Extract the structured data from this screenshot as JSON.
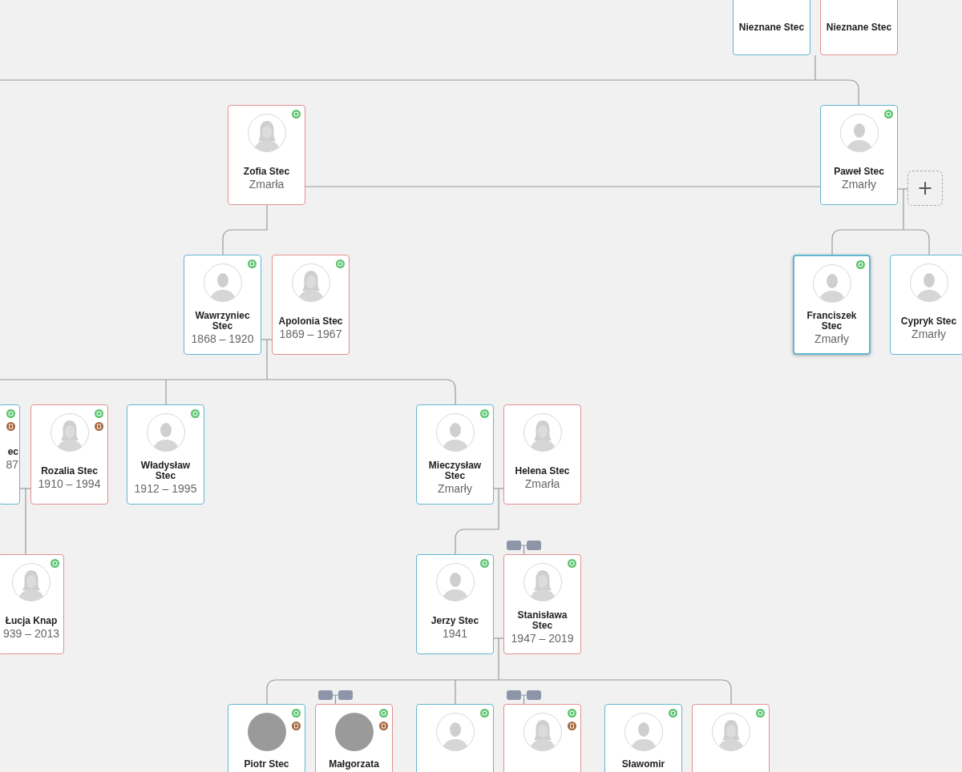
{
  "people": [
    {
      "name": "Nieznane Stec",
      "kind": "male",
      "avatar": false,
      "selected": false,
      "synced": false,
      "has_document": false
    },
    {
      "name": "Nieznane Stec",
      "kind": "female",
      "avatar": false,
      "selected": false,
      "synced": false,
      "has_document": false
    },
    {
      "name": "Zofia Stec",
      "dates": "Zmarła",
      "kind": "female",
      "avatar": true,
      "has_photo": false,
      "selected": false,
      "synced": true,
      "has_document": false,
      "partner_icon": false
    },
    {
      "name": "Paweł Stec",
      "dates": "Zmarły",
      "kind": "male",
      "avatar": true,
      "has_photo": false,
      "selected": false,
      "synced": true,
      "has_document": false,
      "partner_icon": false
    },
    {
      "name": "Wawrzyniec Stec",
      "dates": "1868 – 1920",
      "kind": "male",
      "avatar": true,
      "has_photo": false,
      "selected": false,
      "synced": true,
      "has_document": false,
      "partner_icon": false
    },
    {
      "name": "Apolonia Stec",
      "dates": "1869 – 1967",
      "kind": "female",
      "avatar": true,
      "has_photo": false,
      "selected": false,
      "synced": true,
      "has_document": false,
      "partner_icon": false
    },
    {
      "name": "Franciszek Stec",
      "dates": "Zmarły",
      "kind": "male",
      "avatar": true,
      "has_photo": false,
      "selected": true,
      "synced": true,
      "has_document": false,
      "partner_icon": false
    },
    {
      "name": "Cypryk Stec",
      "dates": "Zmarły",
      "kind": "male",
      "avatar": true,
      "has_photo": false,
      "selected": false,
      "synced": false,
      "has_document": false,
      "partner_icon": false
    },
    {
      "name": "ec",
      "dates": "87",
      "kind": "male",
      "avatar": false,
      "selected": false,
      "synced": true,
      "has_document": true,
      "partner_icon": false
    },
    {
      "name": "Rozalia Stec",
      "dates": "1910 – 1994",
      "kind": "female",
      "avatar": true,
      "has_photo": false,
      "selected": false,
      "synced": true,
      "has_document": true,
      "partner_icon": false
    },
    {
      "name": "Władysław Stec",
      "dates": "1912 – 1995",
      "kind": "male",
      "avatar": true,
      "has_photo": false,
      "selected": false,
      "synced": true,
      "has_document": false,
      "partner_icon": false
    },
    {
      "name": "Mieczysław Stec",
      "dates": "Zmarły",
      "kind": "male",
      "avatar": true,
      "has_photo": false,
      "selected": false,
      "synced": true,
      "has_document": false,
      "partner_icon": false
    },
    {
      "name": "Helena Stec",
      "dates": "Zmarła",
      "kind": "female",
      "avatar": true,
      "has_photo": false,
      "selected": false,
      "synced": false,
      "has_document": false,
      "partner_icon": false
    },
    {
      "name": "Łucja Knap",
      "dates": "939 – 2013",
      "kind": "female",
      "avatar": true,
      "has_photo": false,
      "selected": false,
      "synced": true,
      "has_document": false,
      "partner_icon": false
    },
    {
      "name": "Jerzy Stec",
      "dates": "1941",
      "kind": "male",
      "avatar": true,
      "has_photo": false,
      "selected": false,
      "synced": true,
      "has_document": false,
      "partner_icon": false
    },
    {
      "name": "Stanisława Stec",
      "dates": "1947 – 2019",
      "kind": "female",
      "avatar": true,
      "has_photo": false,
      "selected": false,
      "synced": true,
      "has_document": false,
      "partner_icon": true
    },
    {
      "name": "Piotr Stec",
      "kind": "male",
      "avatar": true,
      "has_photo": true,
      "selected": false,
      "synced": true,
      "has_document": true,
      "partner_icon": false
    },
    {
      "name": "Małgorzata",
      "kind": "female",
      "avatar": true,
      "has_photo": true,
      "selected": false,
      "synced": true,
      "has_document": true,
      "partner_icon": true
    },
    {
      "kind": "male",
      "avatar": true,
      "has_photo": false,
      "selected": false,
      "synced": true,
      "has_document": false,
      "partner_icon": false
    },
    {
      "kind": "female",
      "avatar": true,
      "has_photo": false,
      "selected": false,
      "synced": true,
      "has_document": true,
      "partner_icon": true
    },
    {
      "name": "Sławomir",
      "kind": "male",
      "avatar": true,
      "has_photo": false,
      "selected": false,
      "synced": true,
      "has_document": false,
      "partner_icon": false
    },
    {
      "kind": "female",
      "avatar": true,
      "has_photo": false,
      "selected": false,
      "synced": true,
      "has_document": false,
      "partner_icon": false
    }
  ],
  "add_button": {
    "label": "+"
  }
}
